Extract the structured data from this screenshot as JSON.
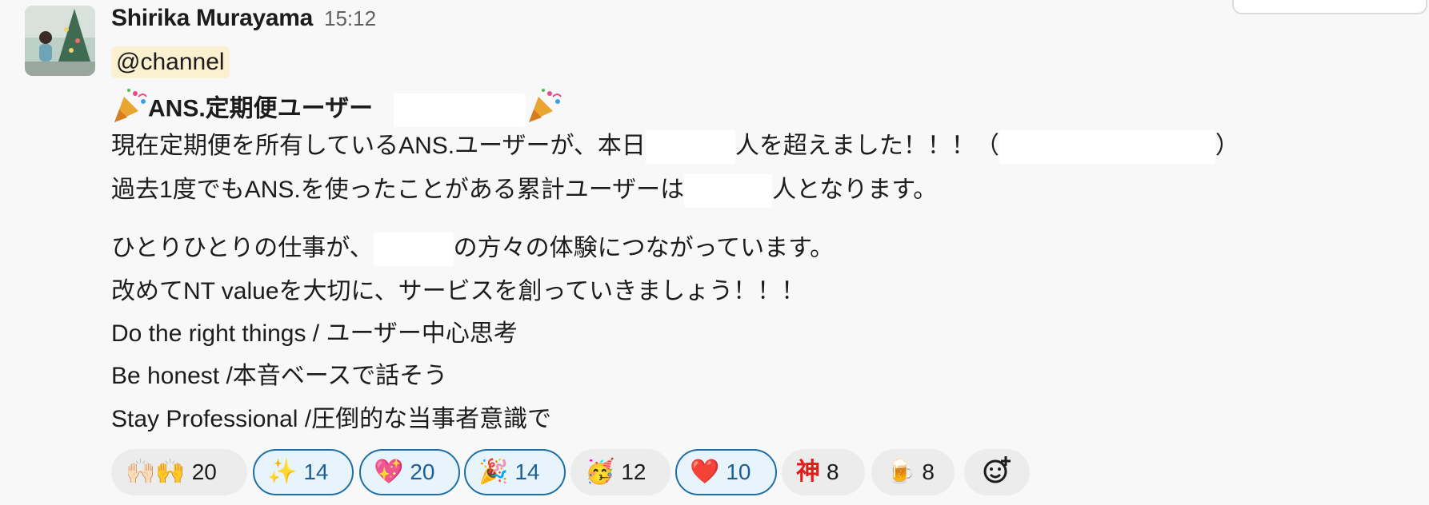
{
  "message": {
    "author": "Shirika Murayama",
    "time": "15:12",
    "mention": "@channel",
    "title": "ANS.定期便ユーザー",
    "lines": [
      {
        "before": "現在定期便を所有しているANS.ユーザーが、本日",
        "middle": "人を超えました！！！（",
        "after": "）"
      },
      {
        "before": "過去1度でもANS.を使ったことがある累計ユーザーは",
        "after": "人となります。"
      },
      {
        "before": "ひとりひとりの仕事が、",
        "after": "の方々の体験につながっています。"
      },
      {
        "text": "改めてNT valueを大切に、サービスを創っていきましょう！！！"
      },
      {
        "text": "Do the right things / ユーザー中心思考"
      },
      {
        "text": "Be honest /本音ベースで話そう"
      },
      {
        "text": "Stay Professional /圧倒的な当事者意識で"
      }
    ]
  },
  "reactions": [
    {
      "icon": "raised-hands-icon",
      "glyph": "🙌🏻🙌",
      "count": "20",
      "active": false
    },
    {
      "icon": "sparkles-icon",
      "glyph": "✨",
      "count": "14",
      "active": true
    },
    {
      "icon": "sparkling-heart-icon",
      "glyph": "💖",
      "count": "20",
      "active": true
    },
    {
      "icon": "party-popper-icon",
      "glyph": "🎉",
      "count": "14",
      "active": true
    },
    {
      "icon": "partying-face-icon",
      "glyph": "🥳",
      "count": "12",
      "active": false
    },
    {
      "icon": "red-heart-icon",
      "glyph": "❤️",
      "count": "10",
      "active": true
    },
    {
      "icon": "kami-icon",
      "glyph": "神",
      "count": "8",
      "active": false
    },
    {
      "icon": "beer-mug-icon",
      "glyph": "🍺",
      "count": "8",
      "active": false
    }
  ],
  "colors": {
    "accent": "#1d6fa5",
    "mention_bg": "#fbf0d0",
    "kami_red": "#e21b1b"
  }
}
